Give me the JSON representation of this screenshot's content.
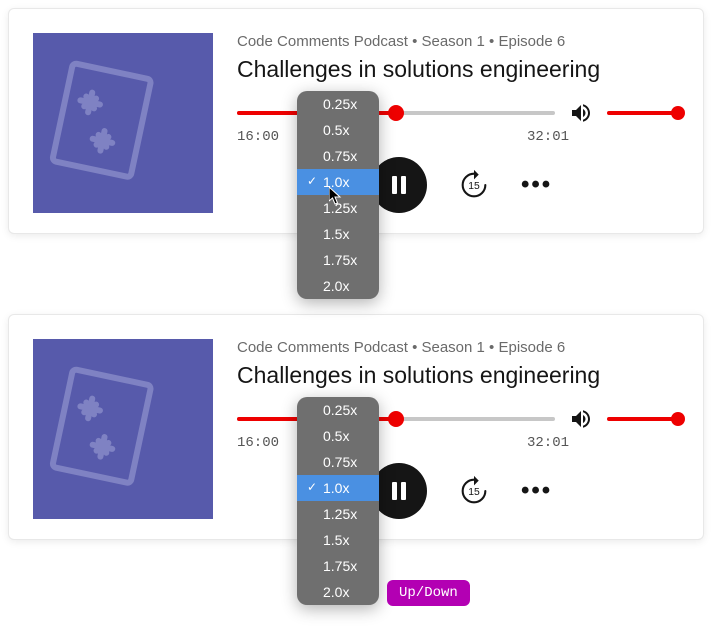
{
  "player1": {
    "crumb": "Code Comments Podcast • Season 1 • Episode 6",
    "title": "Challenges in solutions engineering",
    "currentTime": "16:00",
    "duration": "32:01",
    "progressPercent": 50,
    "speedMenu": {
      "options": [
        "0.25x",
        "0.5x",
        "0.75x",
        "1.0x",
        "1.25x",
        "1.5x",
        "1.75x",
        "2.0x"
      ],
      "selected": "1.0x"
    },
    "skipBackSeconds": "15",
    "skipFwdSeconds": "15"
  },
  "player2": {
    "crumb": "Code Comments Podcast • Season 1 • Episode 6",
    "title": "Challenges in solutions engineering",
    "currentTime": "16:00",
    "duration": "32:01",
    "progressPercent": 50,
    "speedMenu": {
      "options": [
        "0.25x",
        "0.5x",
        "0.75x",
        "1.0x",
        "1.25x",
        "1.5x",
        "1.75x",
        "2.0x"
      ],
      "selected": "1.0x"
    },
    "skipBackSeconds": "15",
    "skipFwdSeconds": "15",
    "hintBadge": "Up/Down"
  }
}
